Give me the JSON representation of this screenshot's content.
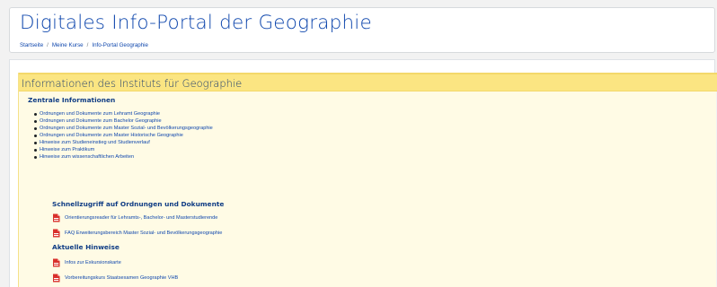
{
  "header": {
    "title": "Digitales Info-Portal der Geographie",
    "breadcrumb": [
      "Startseite",
      "Meine Kurse",
      "Info-Portal Geographie"
    ],
    "separator": "/"
  },
  "info_box": {
    "title": "Informationen des Instituts für Geographie",
    "zentral": {
      "heading": "Zentrale Informationen",
      "links": [
        "Ordnungen und Dokumente zum Lehramt Geographie",
        "Ordnungen und Dokumente zum Bachelor Geographie",
        "Ordnungen und Dokumente zum Master Sozial- und Bevölkerungsgeographie",
        "Ordnungen und Dokumente zum Master Historische Geographie",
        "Hinweise zum Studieneinstieg und Studienverlauf",
        "Hinweise zum Praktikum",
        "Hinweise zum wissenschaftlichen Arbeiten"
      ]
    },
    "schnellzugriff": {
      "heading": "Schnellzugriff auf Ordnungen und Dokumente",
      "files": [
        "Orientierungsreader für Lehramts-, Bachelor- und Masterstudierende",
        "FAQ Erweiterungsbereich Master Sozial- und Bevölkerungsgeographie"
      ]
    },
    "aktuell": {
      "heading": "Aktuelle Hinweise",
      "files": [
        "Infos zur Exkursionskarte",
        "Vorbereitungskurs Staatsexamen Geographie VHB"
      ]
    }
  },
  "icons": {
    "file": "pdf-file-icon"
  },
  "colors": {
    "link": "#0f47ad",
    "heading": "#0f3c84",
    "box_background": "#fffbe5",
    "box_header": "#fbe582",
    "pdf_icon": "#d9302b"
  }
}
